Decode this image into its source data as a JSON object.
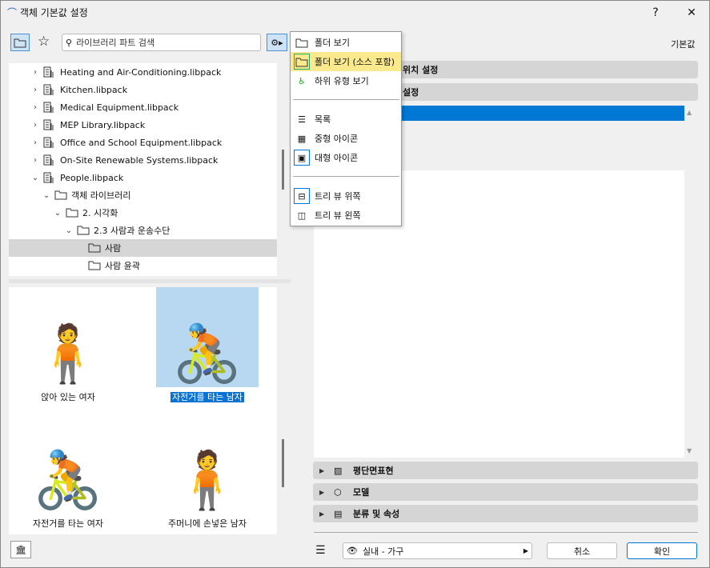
{
  "window": {
    "title": "객체 기본값 설정",
    "help": "?",
    "close": "✕"
  },
  "search": {
    "placeholder": "라이브러리 파트 검색"
  },
  "header_right": "기본값",
  "tree": [
    {
      "label": "Heating and Air-Conditioning.libpack",
      "type": "lib",
      "depth": 0,
      "chev": "›"
    },
    {
      "label": "Kitchen.libpack",
      "type": "lib",
      "depth": 0,
      "chev": "›"
    },
    {
      "label": "Medical Equipment.libpack",
      "type": "lib",
      "depth": 0,
      "chev": "›"
    },
    {
      "label": "MEP Library.libpack",
      "type": "lib",
      "depth": 0,
      "chev": "›"
    },
    {
      "label": "Office and School Equipment.libpack",
      "type": "lib",
      "depth": 0,
      "chev": "›"
    },
    {
      "label": "On-Site Renewable Systems.libpack",
      "type": "lib",
      "depth": 0,
      "chev": "›"
    },
    {
      "label": "People.libpack",
      "type": "lib",
      "depth": 0,
      "chev": "⌄"
    },
    {
      "label": "객체 라이브러리",
      "type": "folder",
      "depth": 1,
      "chev": "⌄"
    },
    {
      "label": "2. 시각화",
      "type": "folder",
      "depth": 2,
      "chev": "⌄"
    },
    {
      "label": "2.3 사람과 운송수단",
      "type": "folder",
      "depth": 3,
      "chev": "⌄"
    },
    {
      "label": "사람",
      "type": "folder",
      "depth": 4,
      "chev": "",
      "selected": true
    },
    {
      "label": "사람 윤곽",
      "type": "folder",
      "depth": 4,
      "chev": ""
    }
  ],
  "thumbs": [
    {
      "label": "앉아 있는 여자"
    },
    {
      "label": "자전거를 타는 남자",
      "selected": true
    },
    {
      "label": "자전거를 타는 여자"
    },
    {
      "label": "주머니에 손넣은 남자"
    }
  ],
  "menu": {
    "items": [
      "폴더 보기",
      "폴더 보기 (소스 포함)",
      "하위 유형 보기",
      "목록",
      "중형 아이콘",
      "대형 아이콘",
      "트리 뷰 위쪽",
      "트리 뷰 왼쪽"
    ]
  },
  "sections_top": [
    "위치 설정",
    "설정"
  ],
  "sections_bottom": [
    "평단면표현",
    "모델",
    "분류 및 속성"
  ],
  "footer": {
    "layer": "실내 - 가구",
    "cancel": "취소",
    "ok": "확인"
  },
  "colors": {
    "accent": "#0078d4",
    "highlight": "#fbe98d"
  }
}
